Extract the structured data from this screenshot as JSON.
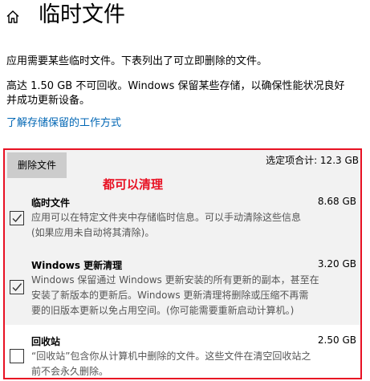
{
  "header": {
    "title": "临时文件"
  },
  "description": "应用需要某些临时文件。下表列出了可立即删除的文件。",
  "note": {
    "lines": [
      "高达 1.50 GB 不可回收。Windows 保留某些存储，以确保性能状况良好",
      "并成功更新设备。"
    ]
  },
  "learn_link": "了解存储保留的工作方式",
  "toolbar": {
    "delete_label": "删除文件",
    "selected_total": "选定项合计: 12.3 GB"
  },
  "annotation": "都可以清理",
  "items": [
    {
      "title": "临时文件",
      "size": "8.68 GB",
      "checked": true,
      "desc_lines": [
        "应用可以在特定文件夹中存储临时信息。可以手动清除这些信息",
        "(如果应用未自动将其清除)。"
      ]
    },
    {
      "title": "Windows 更新清理",
      "size": "3.20 GB",
      "checked": true,
      "desc_lines": [
        "Windows 保留通过 Windows 更新安装的所有更新的副本，甚至在",
        "安装了新版本的更新后。Windows 更新清理将删除或压缩不再需",
        "要的旧版本更新以免占用空间。(你可能需要重新启动计算机。)"
      ]
    },
    {
      "title": "回收站",
      "size": "2.50 GB",
      "checked": false,
      "desc_lines": [
        "“回收站”包含你从计算机中删除的文件。这些文件在清空回收站之",
        "前不会永久删除。"
      ]
    }
  ],
  "colors": {
    "accent_link": "#0066b4",
    "highlight_border": "#e81123",
    "annotation": "#e81123",
    "panel_background": "#f2f2f2",
    "button_background": "#cccccc"
  },
  "icons": {
    "home": "home-icon",
    "check": "checkmark-icon"
  }
}
